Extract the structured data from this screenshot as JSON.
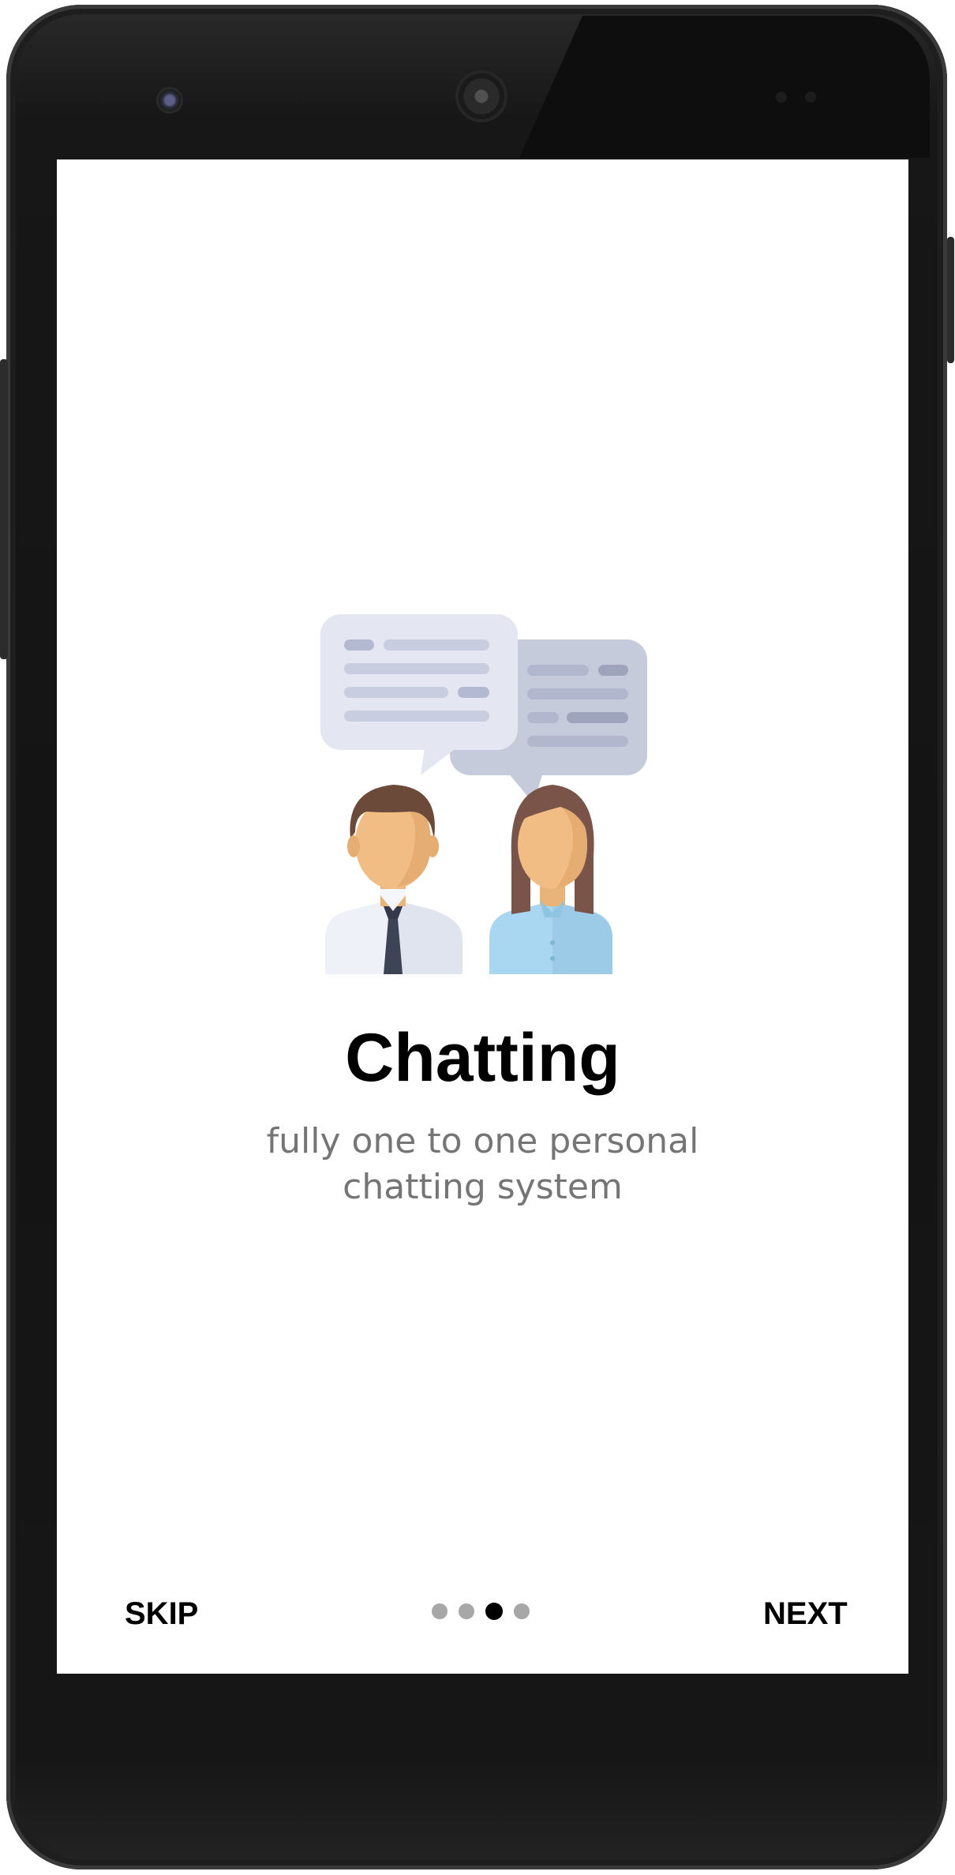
{
  "onboarding": {
    "title": "Chatting",
    "subtitle": "fully one to one personal chatting system",
    "skip_label": "SKIP",
    "next_label": "NEXT",
    "illustration_icon": "two-people-chat-icon",
    "pager": {
      "total": 4,
      "active_index": 2
    }
  },
  "colors": {
    "screen_background": "#ffffff",
    "title": "#000000",
    "subtitle": "#757575",
    "dot_inactive": "#a7a7a7",
    "dot_active": "#000000",
    "device_frame": "#161616"
  }
}
